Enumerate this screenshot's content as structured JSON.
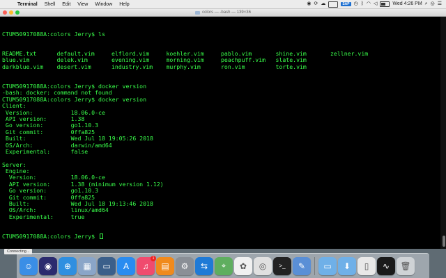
{
  "menubar": {
    "app_name": "Terminal",
    "items": [
      "Shell",
      "Edit",
      "View",
      "Window",
      "Help"
    ],
    "clock": "Wed 4:26 PM",
    "sap_label": "SAP",
    "battery_level": 0.55
  },
  "window": {
    "title": "colors — -bash — 139×36"
  },
  "terminal": {
    "prompt_line_1": "CTUM50917088A:colors Jerry$ ls",
    "ls_rows": [
      [
        "README.txt",
        "default.vim",
        "elflord.vim",
        "koehler.vim",
        "pablo.vim",
        "shine.vim",
        "zellner.vim"
      ],
      [
        "blue.vim",
        "delek.vim",
        "evening.vim",
        "morning.vim",
        "peachpuff.vim",
        "slate.vim",
        ""
      ],
      [
        "darkblue.vim",
        "desert.vim",
        "industry.vim",
        "murphy.vim",
        "ron.vim",
        "torte.vim",
        ""
      ]
    ],
    "lines": [
      "CTUM50917088A:colors Jerry$ docker version",
      "-bash: docker: command not found",
      "CTUM50917088A:colors Jerry$ docker version",
      "Client:",
      " Version:           18.06.0-ce",
      " API version:       1.38",
      " Go version:        go1.10.3",
      " Git commit:        0ffa825",
      " Built:             Wed Jul 18 19:05:26 2018",
      " OS/Arch:           darwin/amd64",
      " Experimental:      false",
      "",
      "Server:",
      " Engine:",
      "  Version:          18.06.0-ce",
      "  API version:      1.38 (minimum version 1.12)",
      "  Go version:       go1.10.3",
      "  Git commit:       0ffa825",
      "  Built:            Wed Jul 18 19:13:46 2018",
      "  OS/Arch:          linux/amd64",
      "  Experimental:     true"
    ],
    "final_prompt": "CTUM50917088A:colors Jerry$ "
  },
  "status": {
    "text": "Connecting..."
  },
  "dock": {
    "apps": [
      {
        "name": "finder-icon",
        "color": "#3a8ee6",
        "glyph": "☺"
      },
      {
        "name": "siri-icon",
        "color": "#2b2b6e",
        "glyph": "◉"
      },
      {
        "name": "safari-icon",
        "color": "#2f8fe0",
        "glyph": "⊕"
      },
      {
        "name": "preview-icon",
        "color": "#8aa5c8",
        "glyph": "▦"
      },
      {
        "name": "screen-sharing-icon",
        "color": "#3b5f8a",
        "glyph": "▭"
      },
      {
        "name": "app-store-icon",
        "color": "#2a8cf0",
        "glyph": "A"
      },
      {
        "name": "music-icon",
        "color": "#f04b6e",
        "glyph": "♫",
        "badge": "1"
      },
      {
        "name": "books-icon",
        "color": "#f08a1c",
        "glyph": "▤"
      },
      {
        "name": "system-preferences-icon",
        "color": "#8a8f96",
        "glyph": "⚙"
      },
      {
        "name": "teamviewer-icon",
        "color": "#1f7ad6",
        "glyph": "⇆"
      },
      {
        "name": "maps-icon",
        "color": "#5fae5f",
        "glyph": "⌖"
      },
      {
        "name": "photos-icon",
        "color": "#f0f0f0",
        "glyph": "✿"
      },
      {
        "name": "chrome-icon",
        "color": "#e0e0e0",
        "glyph": "◎"
      },
      {
        "name": "terminal-icon",
        "color": "#222222",
        "glyph": ">_"
      },
      {
        "name": "sublime-icon",
        "color": "#5a8fd6",
        "glyph": "✎"
      }
    ],
    "others": [
      {
        "name": "applications-folder-icon",
        "color": "#6fb0e8",
        "glyph": "▭"
      },
      {
        "name": "downloads-folder-icon",
        "color": "#6fb0e8",
        "glyph": "⬇"
      },
      {
        "name": "document-icon",
        "color": "#e8e8e8",
        "glyph": "▯"
      },
      {
        "name": "activity-monitor-icon",
        "color": "#1a1a1a",
        "glyph": "∿"
      },
      {
        "name": "trash-icon",
        "color": "#cfd3d6",
        "glyph": "🗑"
      }
    ]
  }
}
